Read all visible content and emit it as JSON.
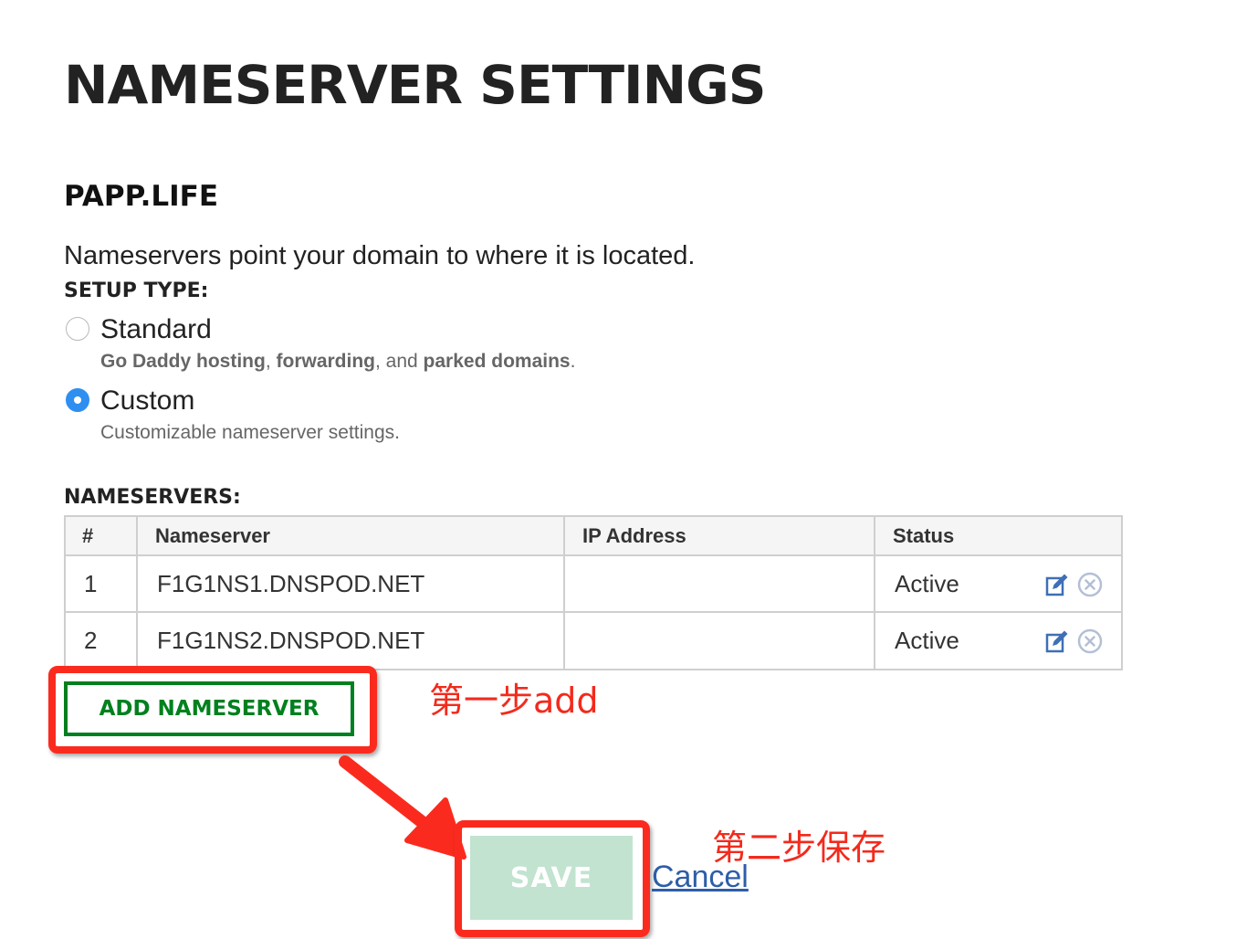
{
  "page": {
    "title": "NAMESERVER SETTINGS",
    "domain": "PAPP.LIFE",
    "description": "Nameservers point your domain to where it is located."
  },
  "setup": {
    "label": "SETUP TYPE:",
    "options": [
      {
        "label": "Standard",
        "selected": false,
        "desc_parts": [
          "Go Daddy hosting",
          ", ",
          "forwarding",
          ", and ",
          "parked domains",
          "."
        ]
      },
      {
        "label": "Custom",
        "selected": true,
        "desc": "Customizable nameserver settings."
      }
    ]
  },
  "nameservers": {
    "label": "NAMESERVERS:",
    "columns": [
      "#",
      "Nameserver",
      "IP Address",
      "Status"
    ],
    "rows": [
      {
        "num": "1",
        "nameserver": "F1G1NS1.DNSPOD.NET",
        "ip": "",
        "status": "Active"
      },
      {
        "num": "2",
        "nameserver": "F1G1NS2.DNSPOD.NET",
        "ip": "",
        "status": "Active"
      }
    ],
    "add_label": "ADD NAMESERVER"
  },
  "actions": {
    "save_label": "SAVE",
    "cancel_label": "Cancel"
  },
  "annotations": {
    "step1": "第一步add",
    "step2": "第二步保存",
    "color": "#fa2b1e"
  },
  "colors": {
    "radio_selected": "#2f8ff0",
    "add_button": "#00801e",
    "save_button_bg": "#c1e3d0",
    "link": "#2d5ea8",
    "icon_edit": "#3f6fb5",
    "icon_delete": "#b3bfd6"
  },
  "icons": {
    "edit": "edit-icon",
    "delete": "close-circle-icon"
  }
}
